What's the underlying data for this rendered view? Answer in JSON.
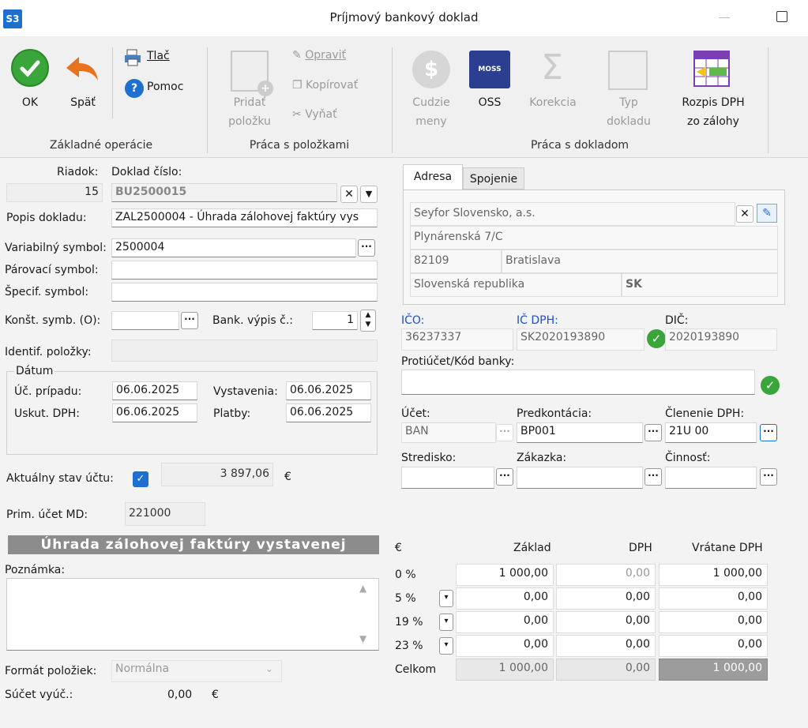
{
  "window": {
    "title": "Príjmový bankový doklad",
    "app_icon": "S3"
  },
  "ribbon": {
    "ok": "OK",
    "back": "Späť",
    "print": "Tlač",
    "help": "Pomoc",
    "group1": "Základné operácie",
    "add_item_1": "Pridať",
    "add_item_2": "položku",
    "edit": "Opraviť",
    "copy": "Kopírovať",
    "remove": "Vyňať",
    "group2": "Práca s položkami",
    "foreign_1": "Cudzie",
    "foreign_2": "meny",
    "oss": "OSS",
    "oss_badge": "MOSS",
    "correction": "Korekcia",
    "doctype_1": "Typ",
    "doctype_2": "dokladu",
    "vat_1": "Rozpis DPH",
    "vat_2": "zo zálohy",
    "group3": "Práca s dokladom"
  },
  "form": {
    "row_label": "Riadok:",
    "row_value": "15",
    "doc_label": "Doklad číslo:",
    "doc_value": "BU2500015",
    "desc_label": "Popis dokladu:",
    "desc_value": "ZAL2500004 - Úhrada zálohovej faktúry vys",
    "vs_label": "Variabilný symbol:",
    "vs_value": "2500004",
    "ps_label": "Párovací symbol:",
    "ps_value": "",
    "ss_label": "Špecif. symbol:",
    "ss_value": "",
    "ks_label": "Konšt. symb. (O):",
    "ks_value": "",
    "bank_label": "Bank. výpis č.:",
    "bank_value": "1",
    "ident_label": "Identif. položky:",
    "ident_value": "",
    "date_group": "Dátum",
    "uc_label": "Úč. prípadu:",
    "uc_value": "06.06.2025",
    "vyst_label": "Vystavenia:",
    "vyst_value": "06.06.2025",
    "usk_label": "Uskut. DPH:",
    "usk_value": "06.06.2025",
    "plat_label": "Platby:",
    "plat_value": "06.06.2025",
    "stav_label": "Aktuálny stav účtu:",
    "stav_value": "3 897,06",
    "stav_currency": "€",
    "prim_label": "Prim. účet MD:",
    "prim_value": "221000",
    "banner": "Úhrada zálohovej faktúry vystavenej",
    "note_label": "Poznámka:",
    "note_value": "",
    "format_label": "Formát položiek:",
    "format_value": "Normálna",
    "sum_label": "Súčet vyúč.:",
    "sum_value": "0,00",
    "sum_currency": "€"
  },
  "partner": {
    "tab_address": "Adresa",
    "tab_link": "Spojenie",
    "name": "Seyfor Slovensko, a.s.",
    "street": "Plynárenská 7/C",
    "zip": "82109",
    "city": "Bratislava",
    "country": "Slovenská republika",
    "country_code": "SK",
    "ico_label": "IČO:",
    "ico": "36237337",
    "icdph_label": "IČ DPH:",
    "icdph": "SK2020193890",
    "dic_label": "DIČ:",
    "dic": "2020193890",
    "account_label": "Protiúčet/Kód banky:",
    "account": "",
    "ucet_label": "Účet:",
    "ucet": "BAN",
    "predk_label": "Predkontácia:",
    "predk": "BP001",
    "clen_label": "Členenie DPH:",
    "clen": "21U 00",
    "stred_label": "Stredisko:",
    "stred": "",
    "zak_label": "Zákazka:",
    "zak": "",
    "cinn_label": "Činnosť:",
    "cinn": ""
  },
  "vat": {
    "currency": "€",
    "col_base": "Základ",
    "col_vat": "DPH",
    "col_total": "Vrátane DPH",
    "rows": [
      {
        "rate": "0 %",
        "base": "1 000,00",
        "vat": "0,00",
        "total": "1 000,00"
      },
      {
        "rate": "5 %",
        "base": "0,00",
        "vat": "0,00",
        "total": "0,00"
      },
      {
        "rate": "19 %",
        "base": "0,00",
        "vat": "0,00",
        "total": "0,00"
      },
      {
        "rate": "23 %",
        "base": "0,00",
        "vat": "0,00",
        "total": "0,00"
      }
    ],
    "total_label": "Celkom",
    "total_base": "1 000,00",
    "total_vat": "0,00",
    "total_total": "1 000,00"
  }
}
